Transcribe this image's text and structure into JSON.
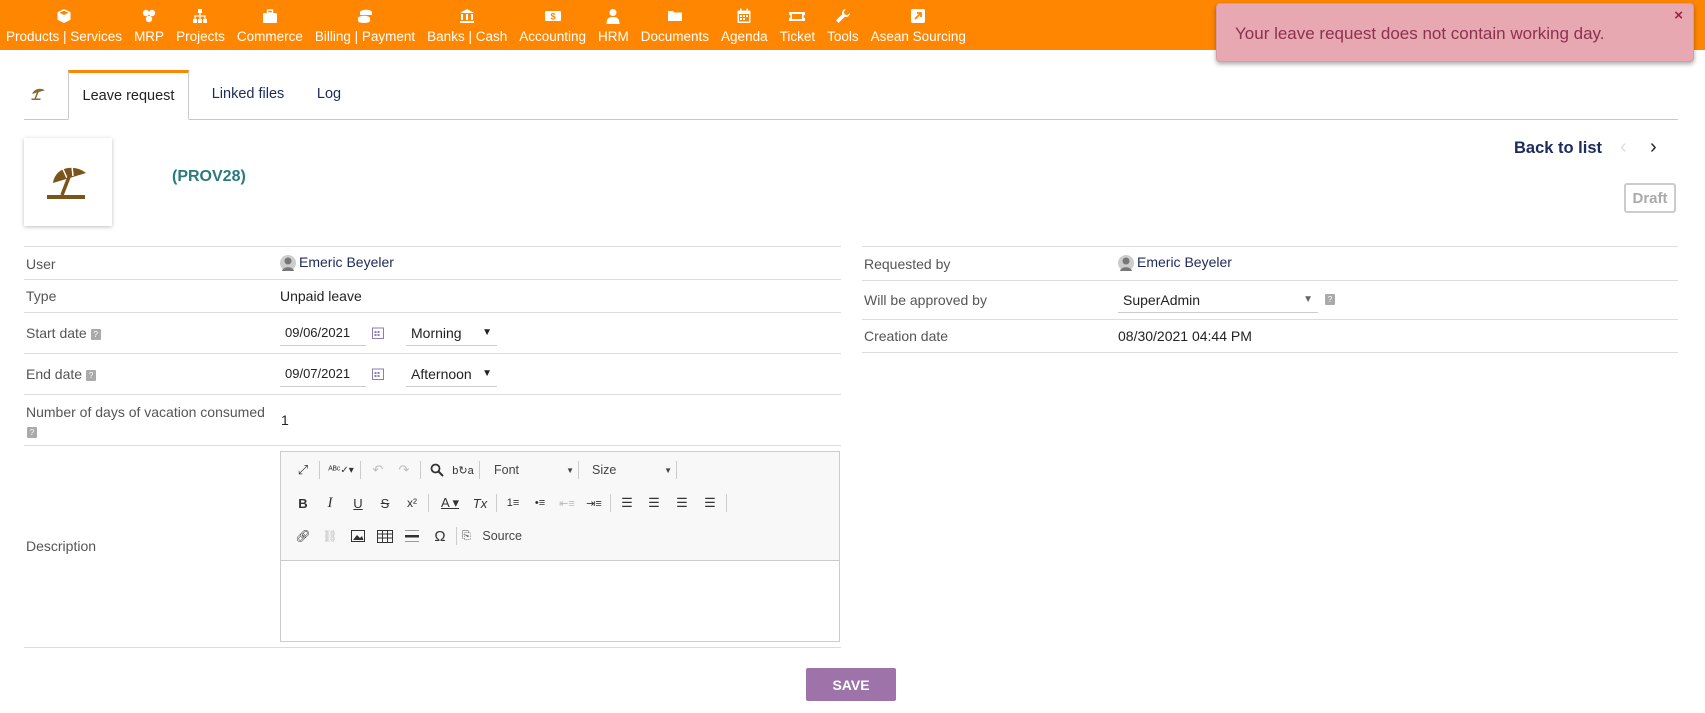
{
  "top_menu": [
    {
      "label": "Products | Services",
      "icon": "cube-icon"
    },
    {
      "label": "MRP",
      "icon": "cubes-icon"
    },
    {
      "label": "Projects",
      "icon": "sitemap-icon"
    },
    {
      "label": "Commerce",
      "icon": "briefcase-icon"
    },
    {
      "label": "Billing | Payment",
      "icon": "coins-icon"
    },
    {
      "label": "Banks | Cash",
      "icon": "bank-icon"
    },
    {
      "label": "Accounting",
      "icon": "dollar-icon"
    },
    {
      "label": "HRM",
      "icon": "user-tie-icon"
    },
    {
      "label": "Documents",
      "icon": "folder-icon"
    },
    {
      "label": "Agenda",
      "icon": "calendar-icon"
    },
    {
      "label": "Ticket",
      "icon": "ticket-icon"
    },
    {
      "label": "Tools",
      "icon": "wrench-icon"
    },
    {
      "label": "Asean Sourcing",
      "icon": "external-link-icon"
    }
  ],
  "toast": {
    "message": "Your leave request does not contain working day.",
    "close": "×"
  },
  "tabs": {
    "icon": "umbrella-beach-icon",
    "leave_request": "Leave request",
    "linked_files": "Linked files",
    "log": "Log"
  },
  "header": {
    "ref": "(PROV28)",
    "back_to_list": "Back to list",
    "prev": "‹",
    "next": "›",
    "status": "Draft"
  },
  "left_fields": {
    "user_label": "User",
    "user_value": "Emeric Beyeler",
    "type_label": "Type",
    "type_value": "Unpaid leave",
    "start_label": "Start date",
    "start_value": "09/06/2021",
    "start_half": "Morning",
    "end_label": "End date",
    "end_value": "09/07/2021",
    "end_half": "Afternoon",
    "days_label": "Number of days of vacation consumed",
    "days_value": "1",
    "description_label": "Description"
  },
  "right_fields": {
    "requested_label": "Requested by",
    "requested_value": "Emeric Beyeler",
    "approver_label": "Will be approved by",
    "approver_value": "SuperAdmin",
    "creation_label": "Creation date",
    "creation_value": "08/30/2021 04:44 PM"
  },
  "editor": {
    "font": "Font",
    "size": "Size",
    "source": "Source"
  },
  "save_label": "SAVE",
  "colors": {
    "topbar": "#ff8600",
    "toast_bg": "#e8a8b1",
    "toast_text": "#8b3150",
    "save": "#9d73a9",
    "ref": "#2a7a7c",
    "link": "#1c2a5c"
  }
}
